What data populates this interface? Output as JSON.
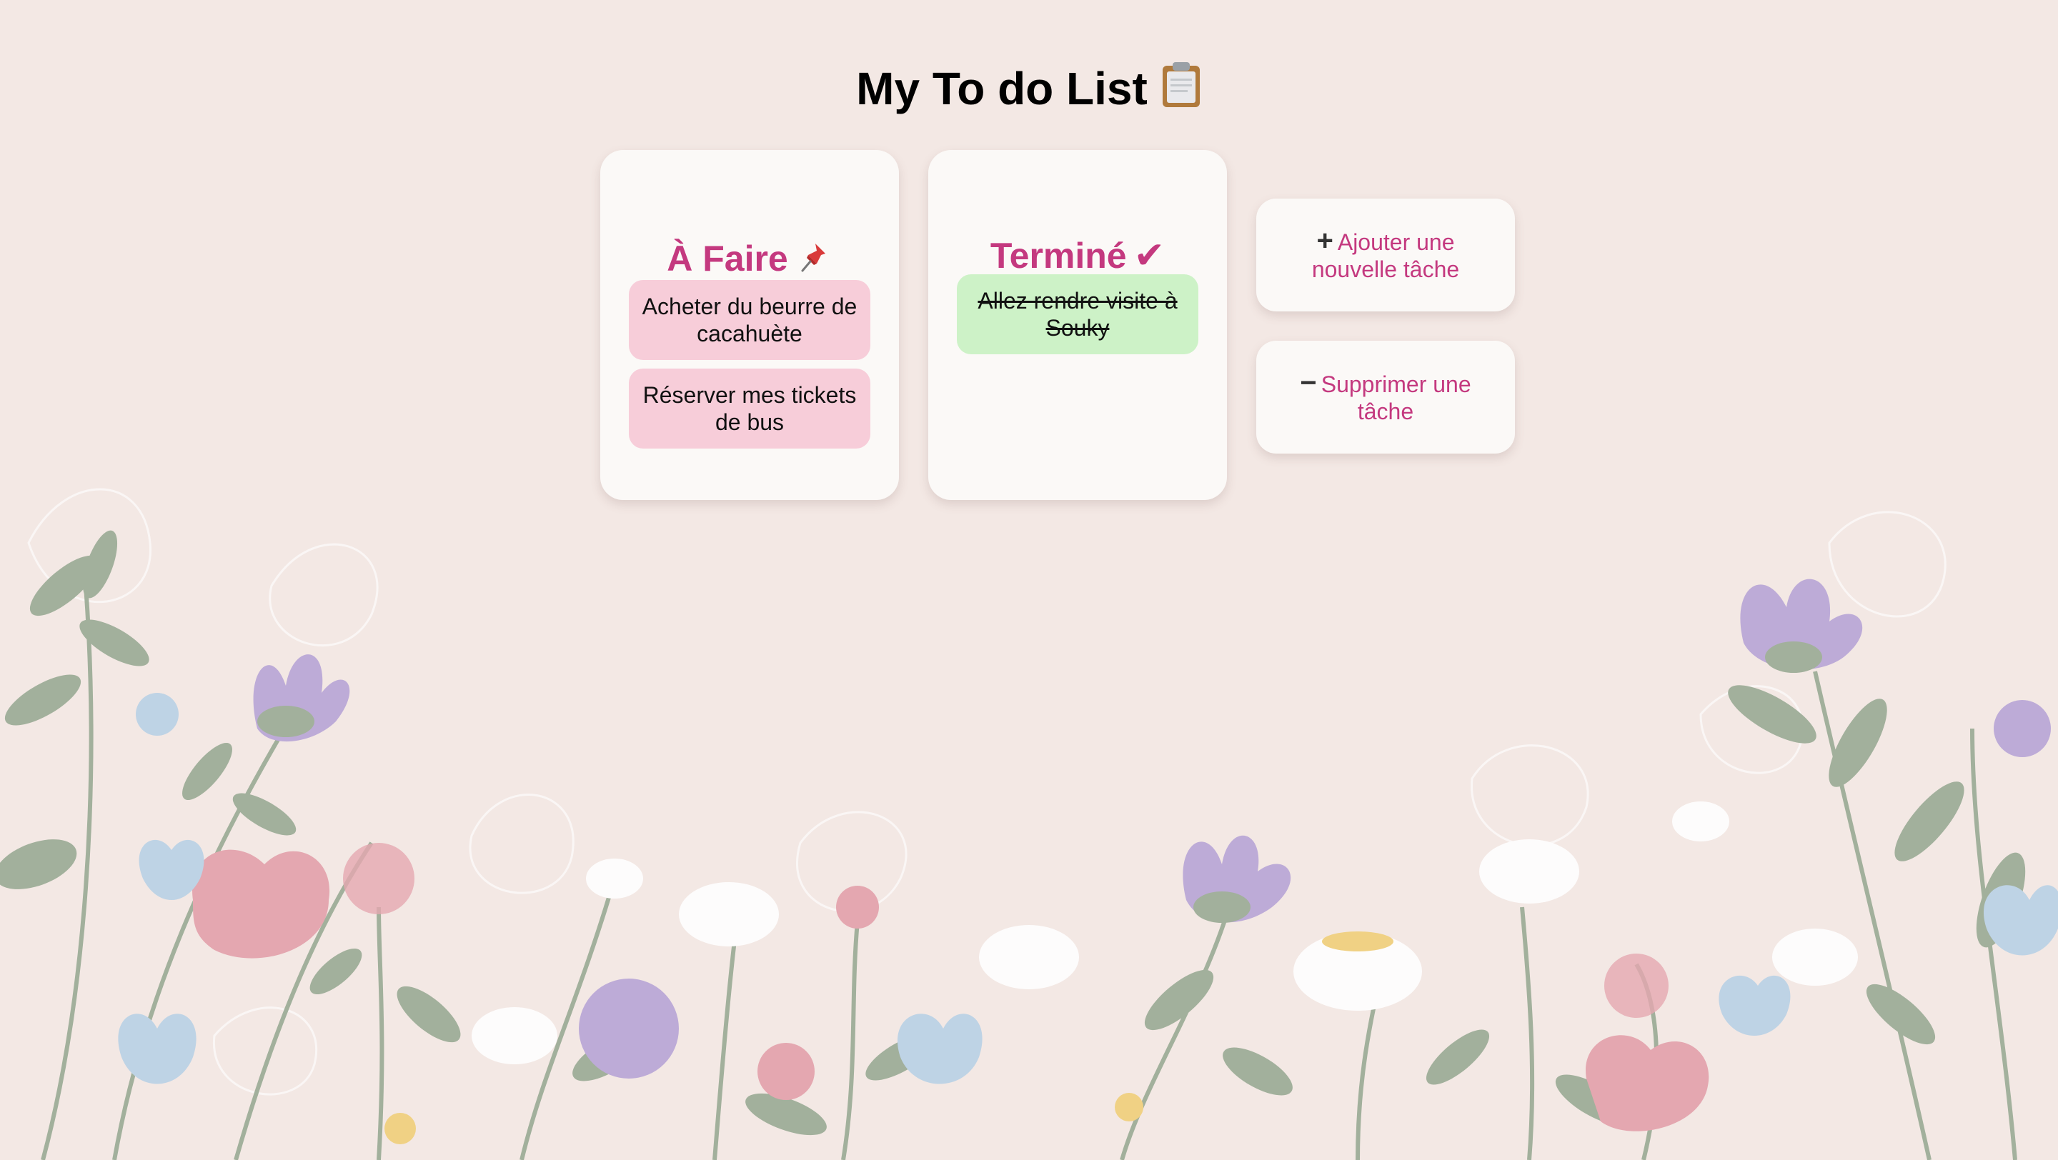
{
  "page": {
    "title": "My To do List",
    "title_icon": "clipboard-icon"
  },
  "todo": {
    "heading": "À Faire",
    "heading_icon": "pushpin-icon",
    "tasks": [
      {
        "text": "Acheter du beurre de cacahuète"
      },
      {
        "text": "Réserver mes tickets de bus"
      }
    ]
  },
  "done": {
    "heading": "Terminé",
    "heading_icon": "check-mark-icon",
    "heading_symbol": "✔",
    "tasks": [
      {
        "text": "Allez rendre visite à Souky"
      }
    ]
  },
  "actions": {
    "add_symbol": "+",
    "add_label": "Ajouter une nouvelle tâche",
    "remove_symbol": "−",
    "remove_label": "Supprimer une tâche"
  },
  "colors": {
    "background": "#f3e8e4",
    "accent": "#c4397f",
    "card": "#fbf9f7",
    "todo_task": "#f7cdd9",
    "done_task": "#cdf2c7"
  }
}
